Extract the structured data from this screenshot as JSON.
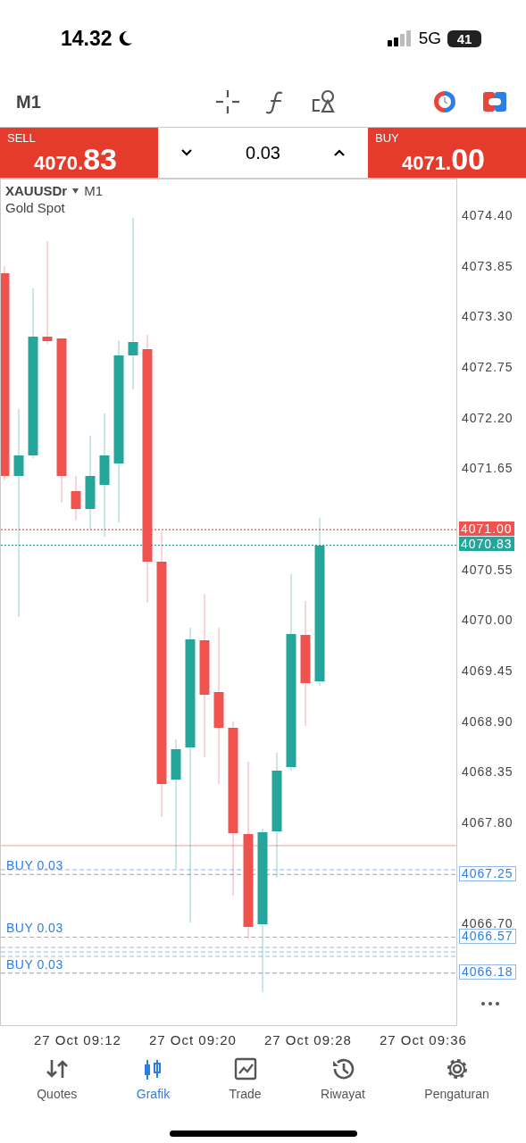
{
  "status_bar": {
    "time": "14.32",
    "network": "5G",
    "battery": "41"
  },
  "toolbar": {
    "timeframe": "M1"
  },
  "trade_panel": {
    "sell": {
      "label": "SELL",
      "price_small": "4070.",
      "price_big": "83"
    },
    "volume": "0.03",
    "buy": {
      "label": "BUY",
      "price_small": "4071.",
      "price_big": "00"
    }
  },
  "chart": {
    "symbol": "XAUUSDr",
    "timeframe": "M1",
    "description": "Gold Spot",
    "price_axis": [
      "4074.40",
      "4073.85",
      "4073.30",
      "4072.75",
      "4072.20",
      "4071.65",
      "4070.55",
      "4070.00",
      "4069.45",
      "4068.90",
      "4068.35",
      "4067.80",
      "4066.70"
    ],
    "ask_tag": "4071.00",
    "bid_tag": "4070.83",
    "orders": [
      {
        "label": "BUY 0.03",
        "price": "4067.25"
      },
      {
        "label": "BUY 0.03",
        "price": "4066.57"
      },
      {
        "label": "BUY 0.03",
        "price": "4066.18"
      }
    ],
    "time_axis": [
      "27 Oct 09:12",
      "27 Oct 09:20",
      "27 Oct 09:28",
      "27 Oct 09:36"
    ]
  },
  "tabs": [
    {
      "label": "Quotes",
      "selected": false
    },
    {
      "label": "Grafik",
      "selected": true
    },
    {
      "label": "Trade",
      "selected": false
    },
    {
      "label": "Riwayat",
      "selected": false
    },
    {
      "label": "Pengaturan",
      "selected": false
    }
  ]
}
